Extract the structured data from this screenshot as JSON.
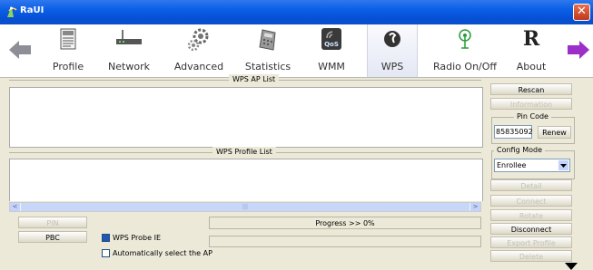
{
  "window": {
    "title": "RaUI",
    "close_glyph": "✕"
  },
  "toolbar": {
    "back_icon": "back-arrow-icon",
    "forward_icon": "forward-arrow-icon",
    "items": [
      {
        "label": "Profile",
        "icon": "profile-icon"
      },
      {
        "label": "Network",
        "icon": "network-icon"
      },
      {
        "label": "Advanced",
        "icon": "advanced-icon"
      },
      {
        "label": "Statistics",
        "icon": "statistics-icon"
      },
      {
        "label": "WMM",
        "icon": "wmm-icon",
        "icon_text": "QoS"
      },
      {
        "label": "WPS",
        "icon": "wps-icon",
        "active": true
      },
      {
        "label": "Radio On/Off",
        "icon": "radio-icon"
      },
      {
        "label": "About",
        "icon": "about-icon",
        "icon_text": "R"
      }
    ]
  },
  "wps": {
    "ap_list_title": "WPS AP List",
    "profile_list_title": "WPS Profile List",
    "pin_button": "PIN",
    "pbc_button": "PBC",
    "progress_text": "Progress >> 0%",
    "probe_ie_label": "WPS Probe IE",
    "probe_ie_checked": true,
    "auto_select_label": "Automatically select the AP",
    "auto_select_checked": false
  },
  "side": {
    "rescan": "Rescan",
    "information": "Information",
    "pin_code_title": "Pin Code",
    "pin_code_value": "85835092",
    "renew": "Renew",
    "config_mode_title": "Config Mode",
    "config_mode_value": "Enrollee",
    "detail": "Detail",
    "connect": "Connect",
    "rotate": "Rotate",
    "disconnect": "Disconnect",
    "export_profile": "Export Profile",
    "delete": "Delete"
  },
  "scrollbar": {
    "thumb_glyph": "|||",
    "left_glyph": "<",
    "right_glyph": ">"
  },
  "colors": {
    "titlebar": "#0a5fe6",
    "panel": "#ece9d8",
    "disabled_text": "#c4c2b4"
  }
}
